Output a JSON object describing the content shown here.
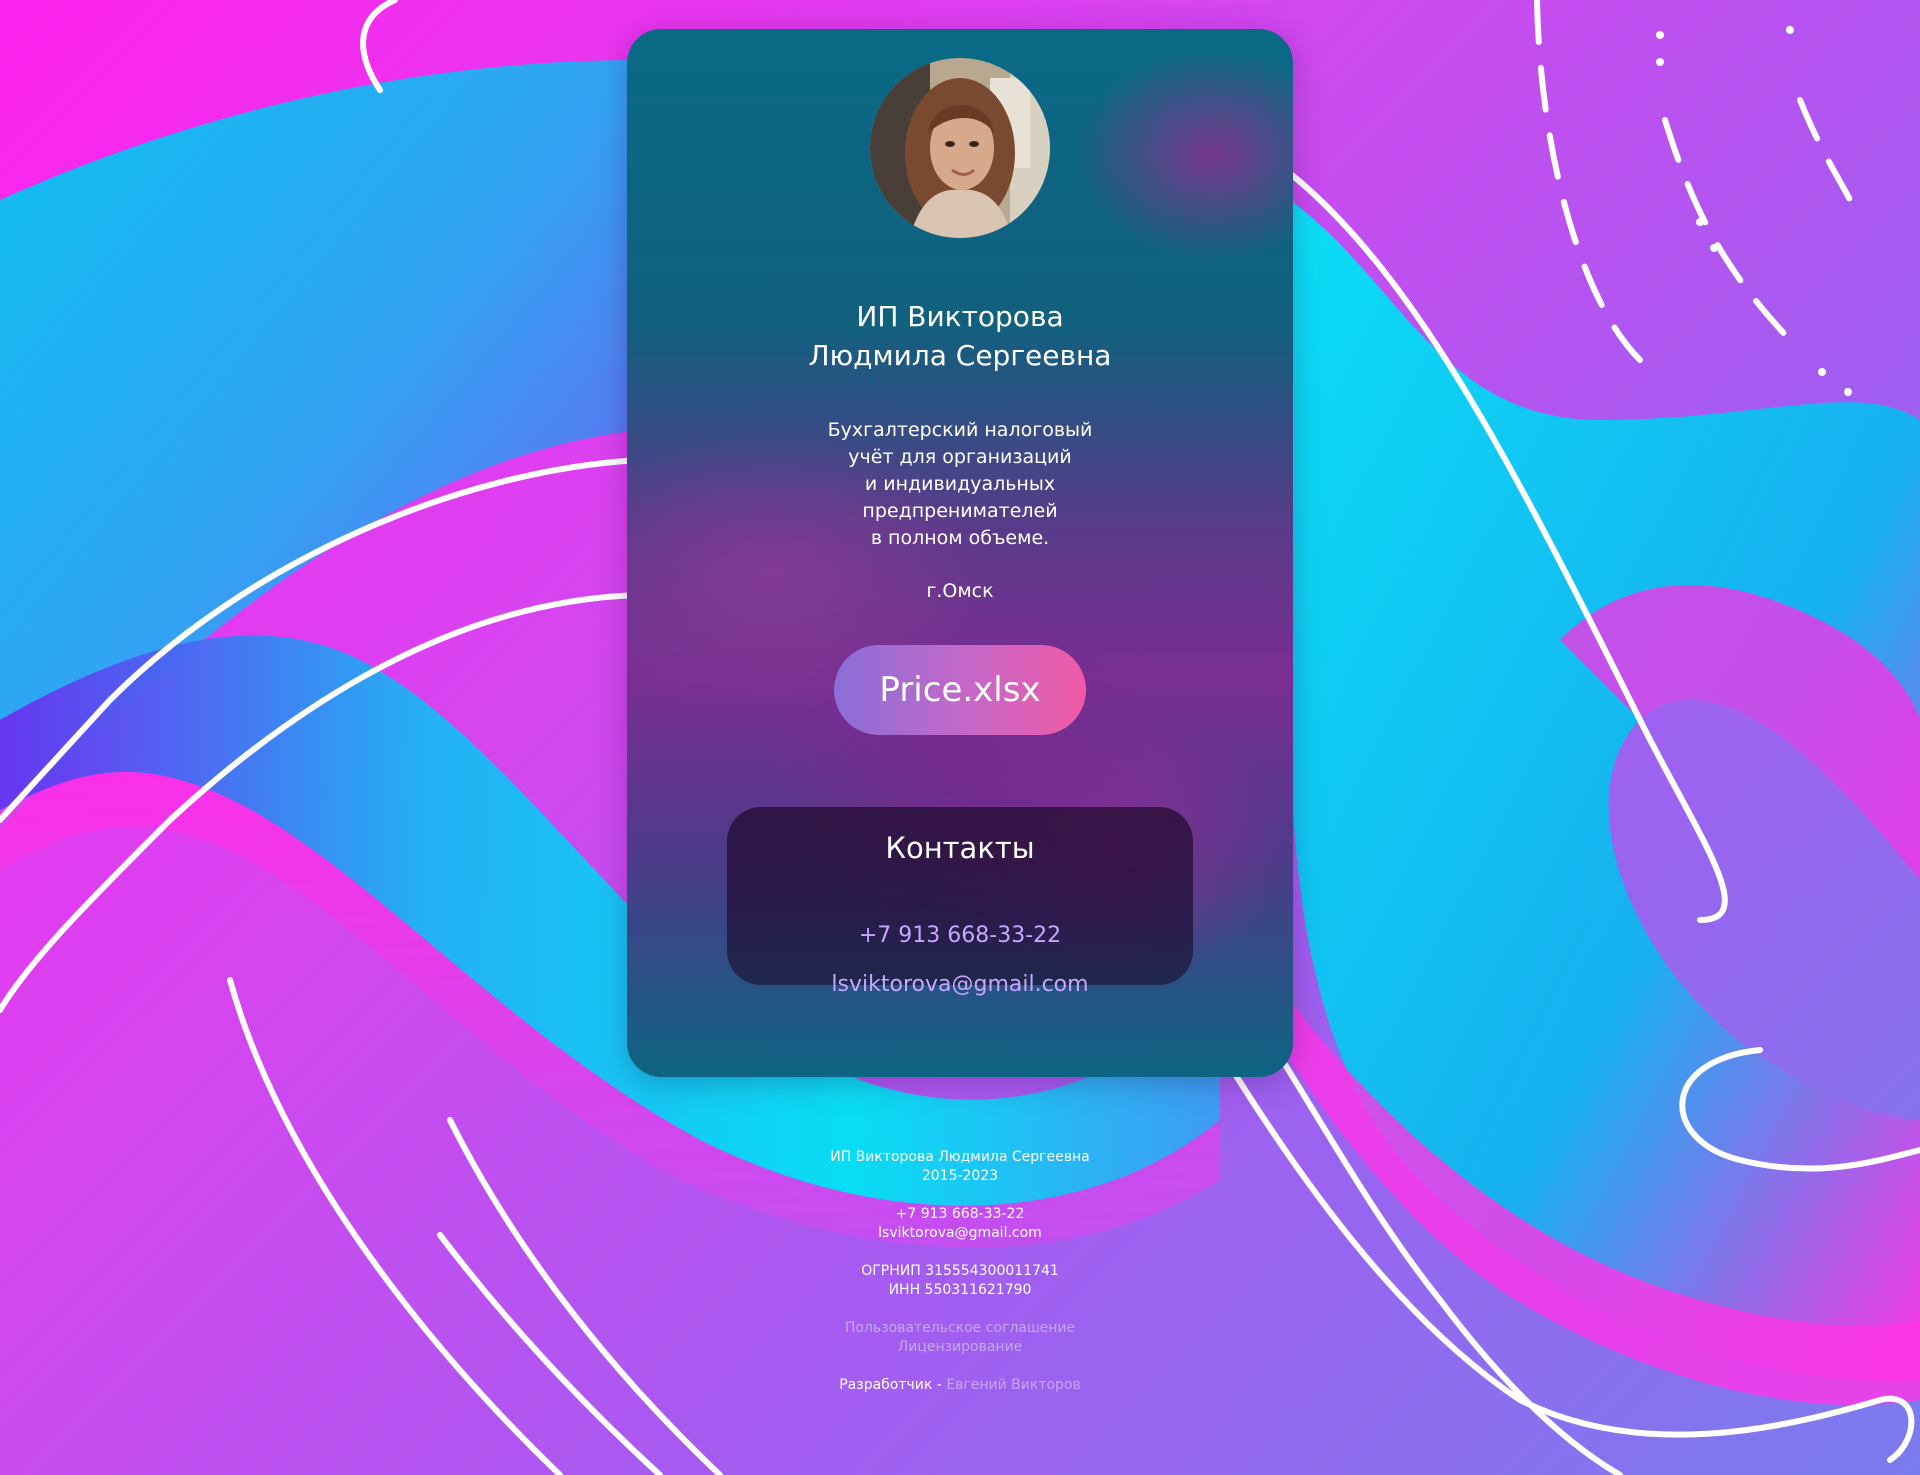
{
  "profile": {
    "avatar_alt": "Photo of Людмила Сергеевна",
    "name_line1": "ИП Викторова",
    "name_line2": "Людмила Сергеевна",
    "description_lines": [
      "Бухгалтерский налоговый",
      "учёт для организаций",
      "и индивидуальных",
      "предпренимателей",
      "в полном объеме."
    ],
    "city": "г.Омск"
  },
  "price_button": {
    "label": "Price.xlsx"
  },
  "contacts": {
    "title": "Контакты",
    "phone": "+7 913 668-33-22",
    "email": "lsviktorova@gmail.com"
  },
  "footer": {
    "company": "ИП Викторова Людмила Сергеевна",
    "years": "2015-2023",
    "phone": "+7 913 668-33-22",
    "email": "lsviktorova@gmail.com",
    "ogrnip": "ОГРНИП 315554300011741",
    "inn": "ИНН 550311621790",
    "agreement_link": "Пользовательское соглашение",
    "licensing_link": "Лицензирование",
    "developer_label": "Разработчик",
    "developer_separator": " - ",
    "developer_link": "Евгений Викторов"
  },
  "colors": {
    "background_magenta": "#ff22ee",
    "background_violet": "#a45cf0",
    "wave_cyan": "#00d8f0",
    "button_start": "#8a6ed8",
    "button_end": "#f05aa6",
    "link_lavender": "#c6a6ff"
  }
}
